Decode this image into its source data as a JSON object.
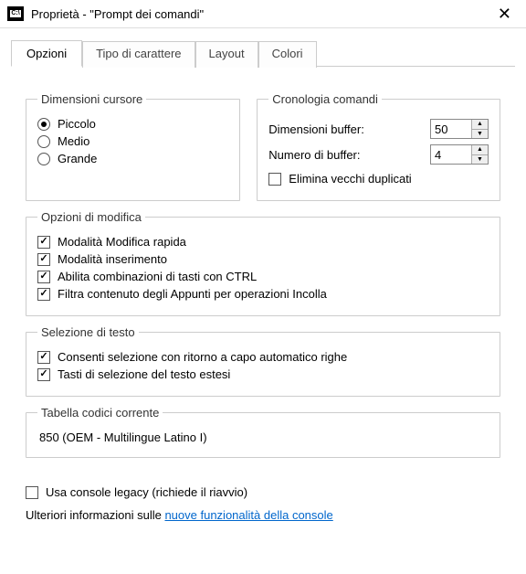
{
  "window": {
    "title": "Proprietà - \"Prompt dei comandi\""
  },
  "tabs": {
    "options": "Opzioni",
    "font": "Tipo di carattere",
    "layout": "Layout",
    "colors": "Colori"
  },
  "cursor": {
    "legend": "Dimensioni cursore",
    "small": "Piccolo",
    "medium": "Medio",
    "large": "Grande"
  },
  "history": {
    "legend": "Cronologia comandi",
    "buffer_size_label": "Dimensioni buffer:",
    "buffer_size_value": "50",
    "buffer_count_label": "Numero di buffer:",
    "buffer_count_value": "4",
    "discard_dupes": "Elimina vecchi duplicati"
  },
  "edit": {
    "legend": "Opzioni di modifica",
    "quick_edit": "Modalità Modifica rapida",
    "insert_mode": "Modalità inserimento",
    "ctrl_keys": "Abilita combinazioni di tasti con CTRL",
    "filter_paste": "Filtra contenuto degli Appunti per operazioni Incolla"
  },
  "text_sel": {
    "legend": "Selezione di testo",
    "wrap": "Consenti selezione con ritorno a capo automatico righe",
    "extended": "Tasti di selezione del testo estesi"
  },
  "codepage": {
    "legend": "Tabella codici corrente",
    "value": "850   (OEM - Multilingue Latino I)"
  },
  "legacy": {
    "label": "Usa console legacy (richiede il riavvio)"
  },
  "info": {
    "prefix": "Ulteriori informazioni sulle ",
    "link": "nuove funzionalità della console"
  }
}
